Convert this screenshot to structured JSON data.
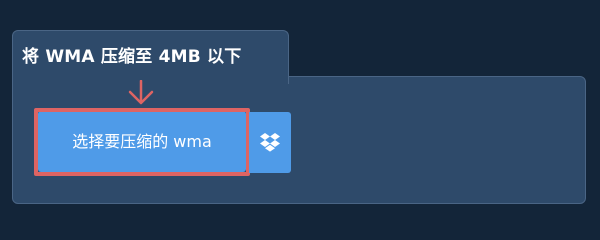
{
  "tab": {
    "title": "将 WMA 压缩至 4MB 以下"
  },
  "upload": {
    "button_label": "选择要压缩的 wma"
  },
  "icons": {
    "pointer": "arrow-down-icon",
    "cloud": "dropbox-icon"
  },
  "colors": {
    "background": "#132539",
    "panel": "#2e4a6a",
    "button": "#4f9be8",
    "highlight": "#de6463"
  }
}
